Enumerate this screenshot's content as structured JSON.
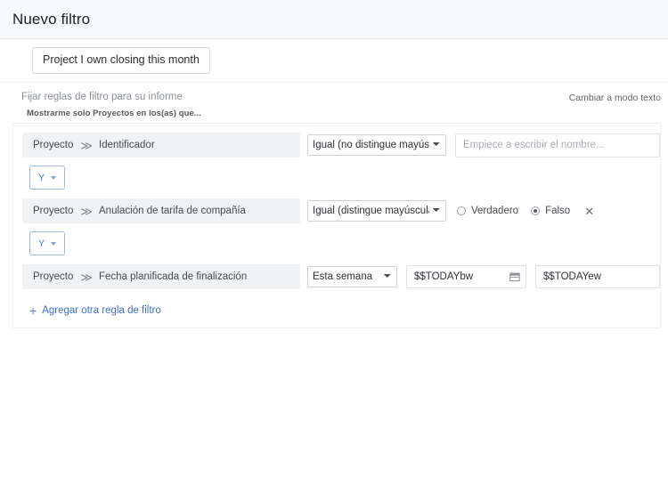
{
  "header": {
    "title": "Nuevo filtro"
  },
  "tabstrip": {
    "saved_filter_label": "Project I own closing this month"
  },
  "subheader": {
    "left_label": "Fijar reglas de filtro para su informe",
    "mode_toggle_label": "Cambiar a modo texto",
    "helper_text": "Mostrarme solo Proyectos en los(as) que..."
  },
  "rules": [
    {
      "field_scope": "Proyecto",
      "field_separator": "≫",
      "field_name": "Identificador",
      "operator": "Igual (no distingue mayúscula",
      "value_placeholder": "Empiece a escribir el nombre...",
      "value": ""
    },
    {
      "field_scope": "Proyecto",
      "field_separator": "≫",
      "field_name": "Anulación de tarifa de compañía",
      "operator": "Igual (distingue mayúsculas y",
      "radio_true_label": "Verdadero",
      "radio_false_label": "Falso",
      "selected": "Falso",
      "remove_label": "✕"
    },
    {
      "field_scope": "Proyecto",
      "field_separator": "≫",
      "field_name": "Fecha planificada de finalización",
      "operator": "Esta semana",
      "date_from": "$$TODAYbw",
      "date_to": "$$TODAYew"
    }
  ],
  "connectors": [
    {
      "label": "Y"
    },
    {
      "label": "Y"
    }
  ],
  "footer": {
    "add_rule_plus": "+",
    "add_rule_label": "Agregar otra regla de filtro"
  },
  "colors": {
    "accent_blue": "#3d6fc9",
    "connector_border": "#9cb8e8",
    "header_bg": "#f7f8f9",
    "pill_bg": "#f1f2f4",
    "muted_text": "#8c9196"
  }
}
